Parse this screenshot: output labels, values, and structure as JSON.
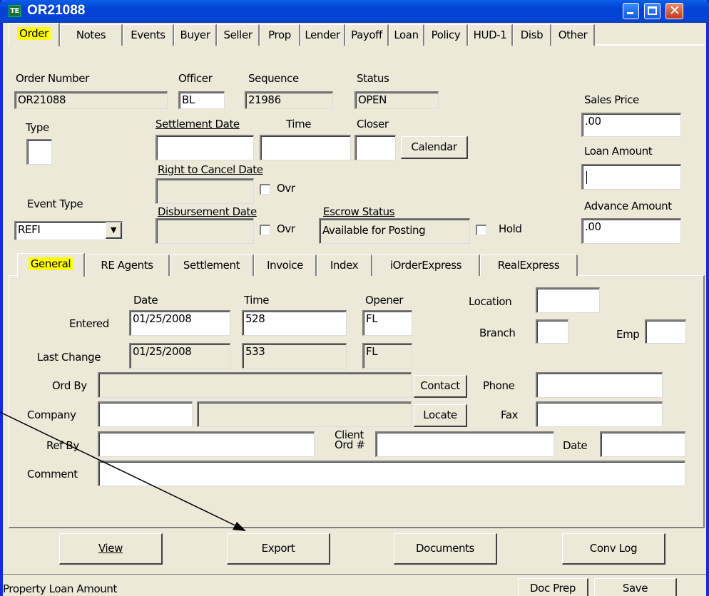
{
  "window": {
    "title": "OR21088",
    "app_icon": "title-app-icon"
  },
  "main_tabs": [
    {
      "label": "Order",
      "active": true
    },
    {
      "label": "Notes"
    },
    {
      "label": "Events"
    },
    {
      "label": "Buyer"
    },
    {
      "label": "Seller"
    },
    {
      "label": "Prop"
    },
    {
      "label": "Lender"
    },
    {
      "label": "Payoff"
    },
    {
      "label": "Loan"
    },
    {
      "label": "Policy"
    },
    {
      "label": "HUD-1"
    },
    {
      "label": "Disb"
    },
    {
      "label": "Other"
    }
  ],
  "order": {
    "order_number_label": "Order Number",
    "order_number": "OR21088",
    "officer_label": "Officer",
    "officer": "BL",
    "sequence_label": "Sequence",
    "sequence": "21986",
    "status_label": "Status",
    "status": "OPEN",
    "type_label": "Type",
    "type": "",
    "settlement_date_label": "Settlement Date",
    "settlement_date": "",
    "time_label": "Time",
    "time": "",
    "closer_label": "Closer",
    "closer": "",
    "calendar_button": "Calendar",
    "right_to_cancel_label": "Right to Cancel Date",
    "right_to_cancel": "",
    "ovr_label": "Ovr",
    "event_type_label": "Event Type",
    "event_type": "REFI",
    "disbursement_label": "Disbursement Date",
    "disbursement": "",
    "escrow_status_label": "Escrow Status",
    "escrow_status": "Available for Posting",
    "hold_label": "Hold",
    "sales_price_label": "Sales Price",
    "sales_price": ".00",
    "loan_amount_label": "Loan Amount",
    "loan_amount": "",
    "advance_amount_label": "Advance Amount",
    "advance_amount": ".00"
  },
  "sub_tabs": [
    {
      "label": "General",
      "active": true
    },
    {
      "label": "RE Agents"
    },
    {
      "label": "Settlement"
    },
    {
      "label": "Invoice"
    },
    {
      "label": "Index"
    },
    {
      "label": "iOrderExpress"
    },
    {
      "label": "RealExpress"
    }
  ],
  "general": {
    "date_header": "Date",
    "time_header": "Time",
    "opener_header": "Opener",
    "entered_label": "Entered",
    "entered_date": "01/25/2008",
    "entered_time": "528",
    "entered_opener": "FL",
    "last_change_label": "Last Change",
    "last_change_date": "01/25/2008",
    "last_change_time": "533",
    "last_change_opener": "FL",
    "location_label": "Location",
    "location": "",
    "branch_label": "Branch",
    "branch": "",
    "emp_label": "Emp",
    "emp": "",
    "ord_by_label": "Ord By",
    "ord_by": "",
    "contact_button": "Contact",
    "phone_label": "Phone",
    "phone": "",
    "company_label": "Company",
    "company_code": "",
    "company_name": "",
    "locate_button": "Locate",
    "fax_label": "Fax",
    "fax": "",
    "ref_by_label": "Ref By",
    "ref_by": "",
    "client_ord_label_1": "Client",
    "client_ord_label_2": "Ord #",
    "client_ord": "",
    "date_label": "Date",
    "date": "",
    "comment_label": "Comment",
    "comment": ""
  },
  "bottom_buttons": {
    "view": "View",
    "export": "Export",
    "documents": "Documents",
    "conv_log": "Conv Log"
  },
  "status_bar": {
    "message": "Property Loan Amount",
    "doc_prep": "Doc Prep",
    "save": "Save"
  },
  "colors": {
    "title_blue": "#0341d4",
    "face": "#ece9d8",
    "highlight": "#ffff00"
  }
}
